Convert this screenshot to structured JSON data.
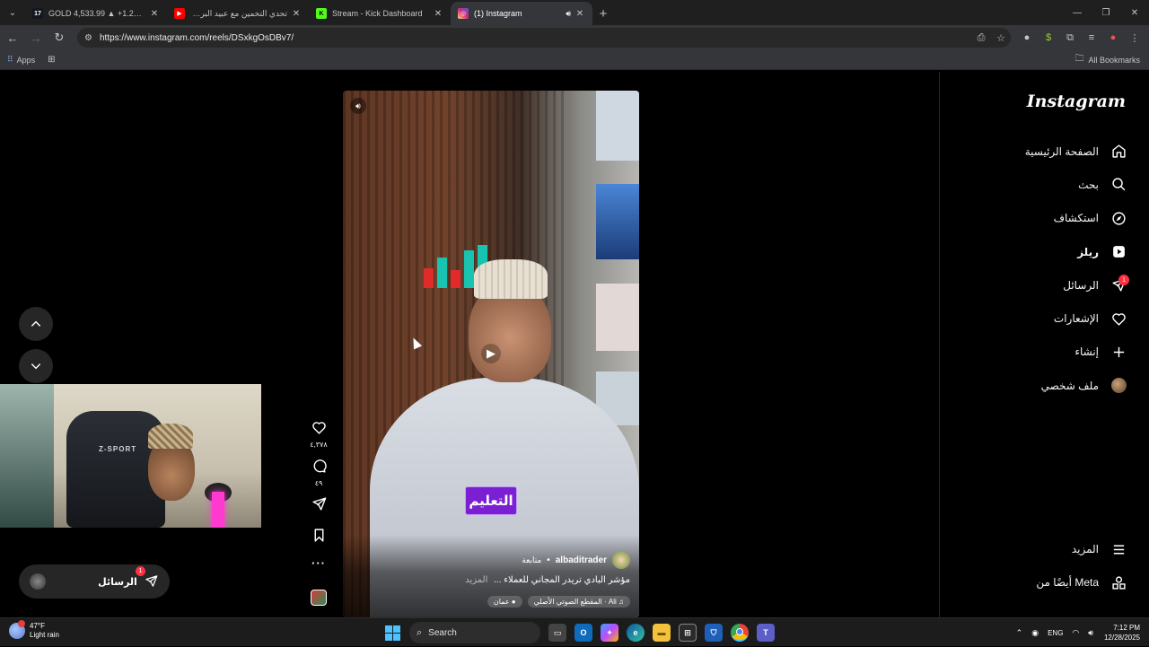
{
  "browser": {
    "tabs": [
      {
        "title": "GOLD 4,533.99 ▲ +1.22% Unn",
        "icon": "tradingview-icon",
        "color": "#131722",
        "glyph": "17",
        "active": false
      },
      {
        "title": "تحدي التخمين مع عبيد البريطاني",
        "icon": "youtube-icon",
        "color": "#ff0000",
        "glyph": "▶",
        "active": false
      },
      {
        "title": "Stream - Kick Dashboard",
        "icon": "kick-icon",
        "color": "#53fc18",
        "glyph": "K",
        "active": false
      },
      {
        "title": "(1) Instagram",
        "icon": "instagram-icon",
        "color": "#d62976",
        "glyph": "◎",
        "active": true
      }
    ],
    "url": "https://www.instagram.com/reels/DSxkgOsDBv7/",
    "bookmarks": {
      "apps": "Apps",
      "all": "All Bookmarks"
    }
  },
  "sidebar": {
    "logo": "Instagram",
    "items": [
      {
        "label": "الصفحة الرئيسية",
        "icon": "home-icon"
      },
      {
        "label": "بحث",
        "icon": "search-icon"
      },
      {
        "label": "استكشاف",
        "icon": "explore-icon"
      },
      {
        "label": "ريلز",
        "icon": "reels-icon"
      },
      {
        "label": "الرسائل",
        "icon": "messages-icon",
        "badge": "1"
      },
      {
        "label": "الإشعارات",
        "icon": "heart-icon"
      },
      {
        "label": "إنشاء",
        "icon": "plus-icon"
      },
      {
        "label": "ملف شخصي",
        "icon": "profile-avatar"
      }
    ],
    "more": "المزيد",
    "meta": "أيضًا من Meta"
  },
  "reel": {
    "overlay_tag": "التعليم",
    "username": "albaditrader",
    "follow": "متابعة",
    "caption": "مؤشر البادي تريدر المجاني للعملاء ...",
    "caption_more": "المزيد",
    "audio_chip": "Ali · المقطع الصوتي الأصلي",
    "location_chip": "عمان"
  },
  "actions": {
    "likes": "٤,٣٧٨",
    "comments": "٤٩"
  },
  "messages_pill": {
    "label": "الرسائل",
    "badge": "1"
  },
  "webcam": {
    "chair_text": "Z-SPORT"
  },
  "taskbar": {
    "weather_temp": "47°F",
    "weather_desc": "Light rain",
    "search": "Search",
    "lang": "ENG",
    "time": "7:12 PM",
    "date": "12/28/2025"
  }
}
